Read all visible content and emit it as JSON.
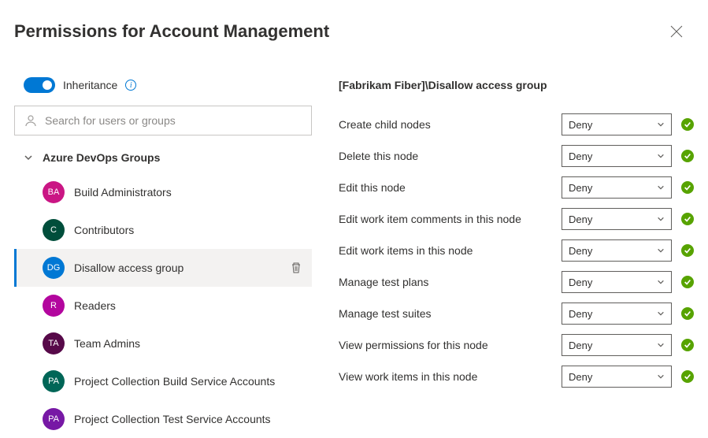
{
  "header": {
    "title": "Permissions for Account Management"
  },
  "left": {
    "inheritance_label": "Inheritance",
    "search_placeholder": "Search for users or groups",
    "groups_heading": "Azure DevOps Groups",
    "groups": [
      {
        "abbr": "BA",
        "label": "Build Administrators",
        "color": "#ca1684",
        "selected": false
      },
      {
        "abbr": "C",
        "label": "Contributors",
        "color": "#004e3b",
        "selected": false
      },
      {
        "abbr": "DG",
        "label": "Disallow access group",
        "color": "#0078d4",
        "selected": true
      },
      {
        "abbr": "R",
        "label": "Readers",
        "color": "#b3069e",
        "selected": false
      },
      {
        "abbr": "TA",
        "label": "Team Admins",
        "color": "#570949",
        "selected": false
      },
      {
        "abbr": "PA",
        "label": "Project Collection Build Service Accounts",
        "color": "#006657",
        "selected": false
      },
      {
        "abbr": "PA",
        "label": "Project Collection Test Service Accounts",
        "color": "#7718a5",
        "selected": false
      }
    ]
  },
  "right": {
    "title": "[Fabrikam Fiber]\\Disallow access group",
    "permissions": [
      {
        "label": "Create child nodes",
        "value": "Deny"
      },
      {
        "label": "Delete this node",
        "value": "Deny"
      },
      {
        "label": "Edit this node",
        "value": "Deny"
      },
      {
        "label": "Edit work item comments in this node",
        "value": "Deny"
      },
      {
        "label": "Edit work items in this node",
        "value": "Deny"
      },
      {
        "label": "Manage test plans",
        "value": "Deny"
      },
      {
        "label": "Manage test suites",
        "value": "Deny"
      },
      {
        "label": "View permissions for this node",
        "value": "Deny"
      },
      {
        "label": "View work items in this node",
        "value": "Deny"
      }
    ]
  }
}
